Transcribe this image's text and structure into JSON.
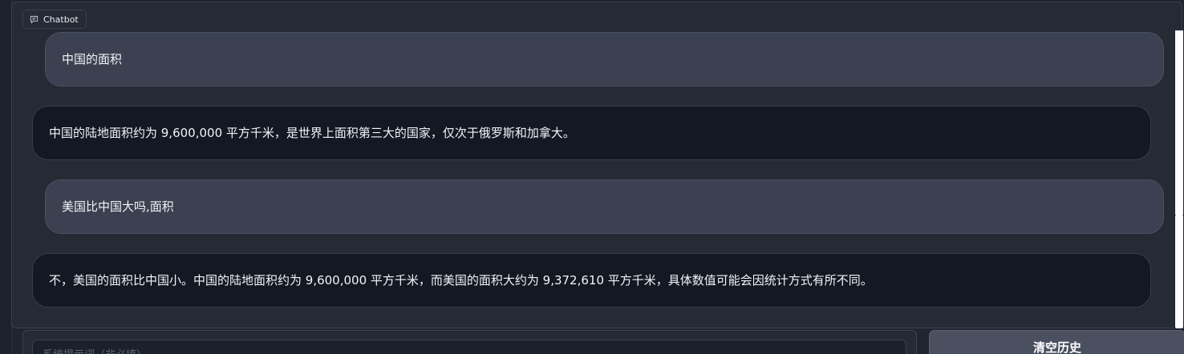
{
  "chatbot": {
    "label": "Chatbot",
    "icon": "chat-icon",
    "messages": [
      {
        "role": "user",
        "text": "中国的面积"
      },
      {
        "role": "assistant",
        "text": "中国的陆地面积约为 9,600,000 平方千米，是世界上面积第三大的国家，仅次于俄罗斯和加拿大。"
      },
      {
        "role": "user",
        "text": "美国比中国大吗,面积"
      },
      {
        "role": "assistant",
        "text": "不，美国的面积比中国小。中国的陆地面积约为 9,600,000 平方千米，而美国的面积大约为 9,372,610 平方千米，具体数值可能会因统计方式有所不同。"
      }
    ]
  },
  "input": {
    "system_placeholder": "系统提示词（非必填）"
  },
  "buttons": {
    "clear_label": "清空历史"
  },
  "colors": {
    "background": "#1f2430",
    "user_bubble": "#3b4150",
    "bot_bubble": "#131823",
    "button": "#4a5060"
  }
}
